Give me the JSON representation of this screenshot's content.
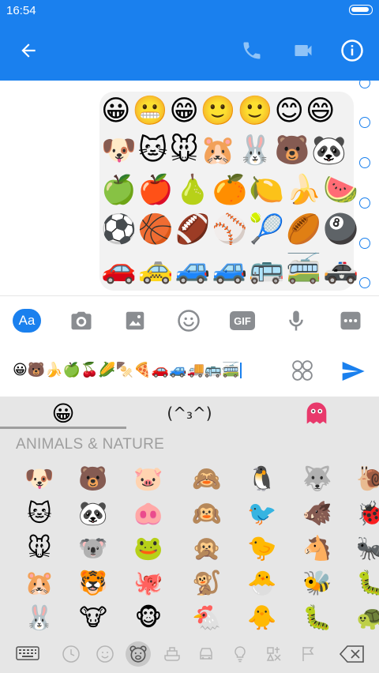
{
  "status_bar": {
    "time": "16:54",
    "battery_level": 0.95
  },
  "app_bar": {
    "back_icon": "arrow-left-icon",
    "call_icon": "phone-icon",
    "video_icon": "video-camera-icon",
    "info_icon": "info-icon"
  },
  "colors": {
    "brand": "#1a80ee",
    "keyboard_bg": "#e6e6e6",
    "muted": "#9e9e9e"
  },
  "chat": {
    "message_rows": [
      "😀😬😁🙂🙂😊😄",
      "🐶🐱🐭🐹🐰🐻🐼",
      "🍏🍎🍐🍊🍋🍌🍉",
      "⚽🏀🏈⚾🎾🏉🎱",
      "🚗🚕🚙🚙🚌🚎🚓"
    ]
  },
  "composer": {
    "aa_label": "Aa",
    "gif_label": "GIF",
    "icons": [
      "camera-icon",
      "image-icon",
      "smiley-icon",
      "gif-icon",
      "microphone-icon",
      "more-icon"
    ],
    "input_value": "😀🐻🍌🍏🍒🌽🍢🍕🚗🚙🚚🚌🚎",
    "send_icon": "send-icon",
    "sticker_icon": "sticker-grid-icon"
  },
  "keyboard": {
    "tabs": [
      {
        "name": "emoji",
        "label": "😀"
      },
      {
        "name": "kaomoji",
        "label": "(^₃^)"
      },
      {
        "name": "stickers",
        "label": "👻"
      }
    ],
    "section_title": "ANIMALS & NATURE",
    "grid": [
      [
        "🐶",
        "🐻",
        "🐷",
        "🙈",
        "🐧",
        "🐺",
        "🐌"
      ],
      [
        "🐱",
        "🐼",
        "🐽",
        "🙉",
        "🐦",
        "🐗",
        "🐞"
      ],
      [
        "🐭",
        "🐨",
        "🐸",
        "🙊",
        "🐤",
        "🐴",
        "🐜"
      ],
      [
        "🐹",
        "🐯",
        "🐙",
        "🐒",
        "🐣",
        "🐝",
        "🐛"
      ],
      [
        "🐰",
        "🐮",
        "🐵",
        "🐔",
        "🐥",
        "🐛",
        "🐢"
      ]
    ],
    "bottom_icons": [
      "keyboard-icon",
      "clock-icon",
      "smiley-icon",
      "bear-icon",
      "food-icon",
      "car-icon",
      "lightbulb-icon",
      "symbols-icon",
      "flag-icon",
      "backspace-icon"
    ]
  }
}
